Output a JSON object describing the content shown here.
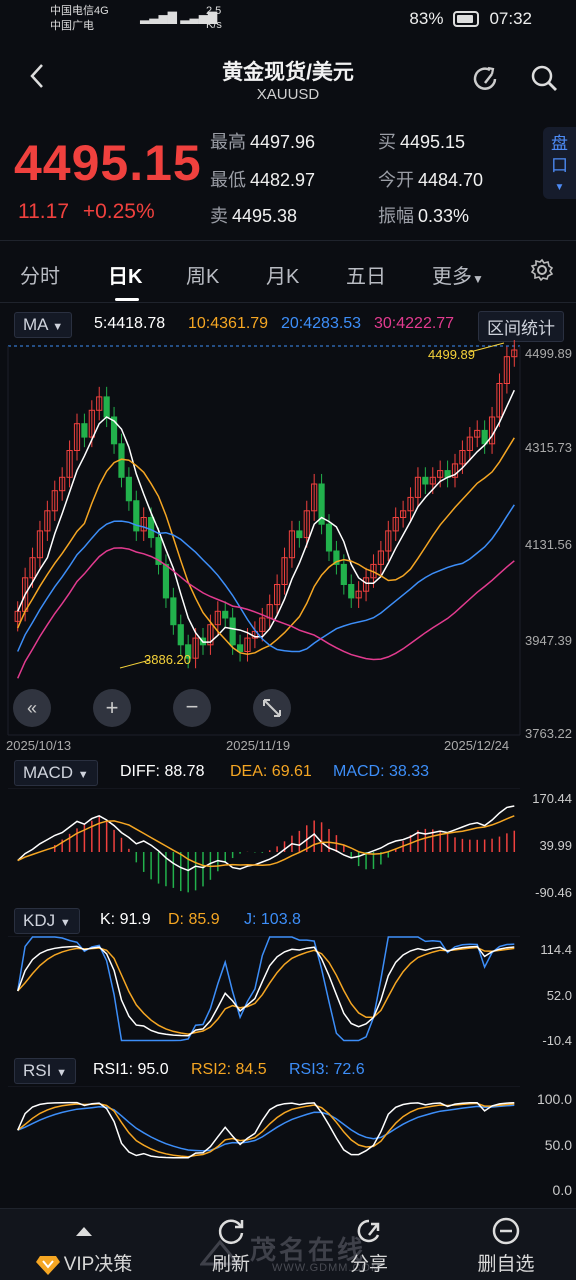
{
  "status_bar": {
    "carrier1": "中国电信4G",
    "carrier2": "中国广电",
    "net_speed": "2.5",
    "net_speed_unit": "K/s",
    "battery": "83%",
    "time": "07:32"
  },
  "header": {
    "title": "黄金现货/美元",
    "subtitle": "XAUUSD"
  },
  "quote": {
    "price": "4495.15",
    "change": "11.17",
    "change_pct": "+0.25%",
    "high_label": "最高",
    "high": "4497.96",
    "buy_label": "买",
    "buy": "4495.15",
    "low_label": "最低",
    "low": "4482.97",
    "open_label": "今开",
    "open": "4484.70",
    "sell_label": "卖",
    "sell": "4495.38",
    "amp_label": "振幅",
    "amp": "0.33%",
    "pankou": "盘口"
  },
  "tabs": [
    "分时",
    "日K",
    "周K",
    "月K",
    "五日",
    "更多",
    ""
  ],
  "active_tab": "日K",
  "ma": {
    "selector": "MA",
    "ma5": "5:4418.78",
    "ma10": "10:4361.79",
    "ma20": "20:4283.53",
    "ma30": "30:4222.77",
    "range_stats": "区间统计"
  },
  "main_chart": {
    "y_ticks": [
      "4499.89",
      "4315.73",
      "4131.56",
      "3947.39",
      "3763.22"
    ],
    "dates": [
      "2025/10/13",
      "2025/11/19",
      "2025/12/24"
    ],
    "max_label": "4499.89",
    "min_label": "3886.20"
  },
  "macd": {
    "selector": "MACD",
    "diff": "DIFF: 88.78",
    "dea": "DEA: 69.61",
    "macd": "MACD: 38.33",
    "y_ticks": [
      "170.44",
      "39.99",
      "-90.46"
    ]
  },
  "kdj": {
    "selector": "KDJ",
    "k": "K: 91.9",
    "d": "D: 85.9",
    "j": "J: 103.8",
    "y_ticks": [
      "114.4",
      "52.0",
      "-10.4"
    ]
  },
  "rsi": {
    "selector": "RSI",
    "rsi1": "RSI1: 95.0",
    "rsi2": "RSI2: 84.5",
    "rsi3": "RSI3: 72.6",
    "y_ticks": [
      "100.0",
      "50.0",
      "0.0"
    ]
  },
  "footer": {
    "vip": "VIP决策",
    "refresh": "刷新",
    "share": "分享",
    "remove": "删自选"
  },
  "watermark": {
    "text": "茂名在线",
    "url": "WWW.GDMM.COM"
  },
  "colors": {
    "up": "#f0413e",
    "down": "#22b14c",
    "ma5": "#ffffff",
    "ma10": "#f5a623",
    "ma20": "#3d8ef8",
    "ma30": "#e23b8f",
    "accent": "#4d8bf5"
  }
}
